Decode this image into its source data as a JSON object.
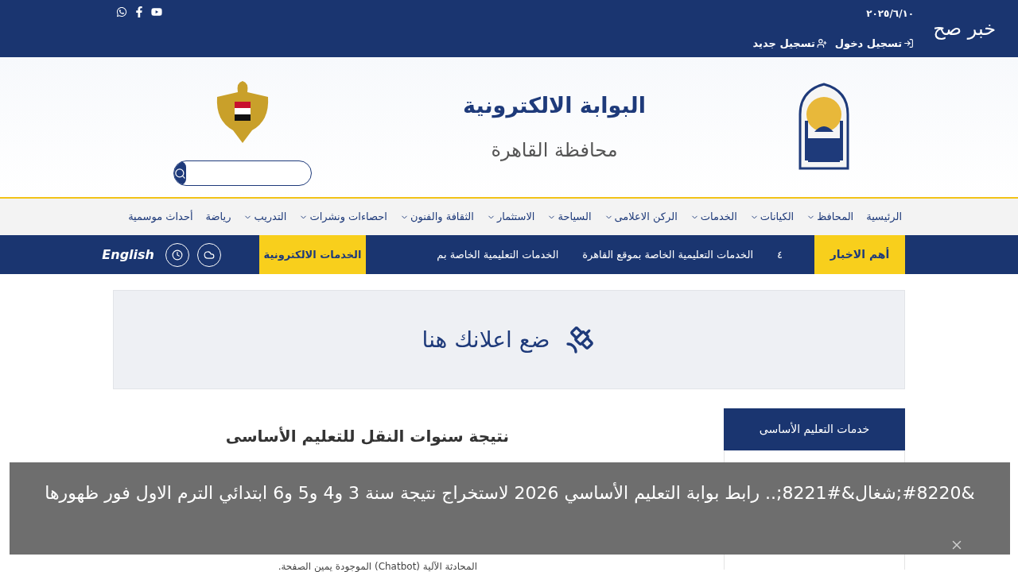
{
  "topbar": {
    "site_logo": "خبر صح",
    "date": "٢٠٢٥/٦/١٠",
    "links": [
      {
        "label": "تسجيل دخول",
        "kind": "login"
      },
      {
        "label": "تسجيل جديد",
        "kind": "register"
      }
    ]
  },
  "header": {
    "title": "البوابة الالكترونية",
    "subtitle": "محافظة القاهرة"
  },
  "nav": [
    {
      "label": "الرئيسية",
      "has_menu": false
    },
    {
      "label": "المحافظ",
      "has_menu": true
    },
    {
      "label": "الكيانات",
      "has_menu": true
    },
    {
      "label": "الخدمات",
      "has_menu": true
    },
    {
      "label": "الركن الاعلامى",
      "has_menu": true
    },
    {
      "label": "السياحة",
      "has_menu": true
    },
    {
      "label": "الاستثمار",
      "has_menu": true
    },
    {
      "label": "الثقافة والفنون",
      "has_menu": true
    },
    {
      "label": "احصاءات ونشرات",
      "has_menu": true
    },
    {
      "label": "التدريب",
      "has_menu": true
    },
    {
      "label": "رياضة",
      "has_menu": false
    },
    {
      "label": "أحداث موسمية",
      "has_menu": false
    }
  ],
  "news_bar": {
    "label": "أهم الاخبار",
    "items": [
      "٤",
      "الخدمات التعليمية الخاصة بموقع القاهرة",
      "الخدمات التعليمية الخاصة بم"
    ],
    "eservices": "الخدمات الالكترونية",
    "language": "English"
  },
  "ad": {
    "text": "ضع اعلانك هنا"
  },
  "article": {
    "title": "نتيجة سنوات النقل للتعليم الأساسى",
    "last_line": "المحادثة الآلية (Chatbot) الموجودة يمين الصفحة."
  },
  "sidebar": {
    "title": "خدمات التعليم الأساسى"
  },
  "caption": {
    "text": "&#8220;شغال&#8221;.. رابط بوابة التعليم الأساسي 2026 لاستخراج نتيجة سنة 3 و4 و5 و6 ابتدائي الترم الاول فور ظهورها"
  }
}
